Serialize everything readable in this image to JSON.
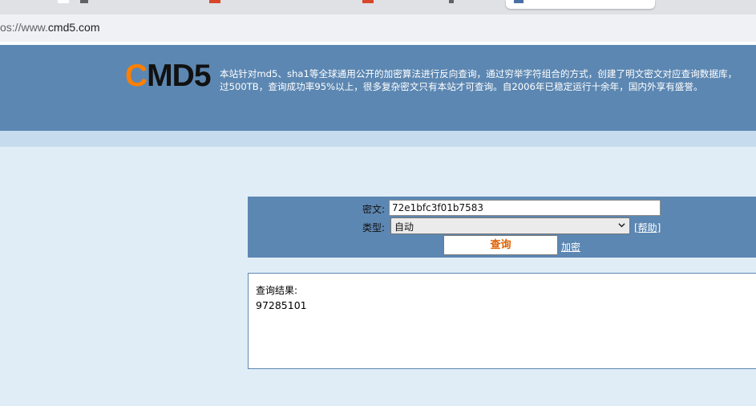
{
  "browser": {
    "url_prefix": "os://www.",
    "url_domain": "cmd5.com"
  },
  "logo": {
    "first": "C",
    "rest": "MD5"
  },
  "header": {
    "intro_line1": "本站针对md5、sha1等全球通用公开的加密算法进行反向查询，通过穷举字符组合的方式，创建了明文密文对应查询数据库，",
    "intro_line2": "过500TB，查询成功率95%以上，很多复杂密文只有本站才可查询。自2006年已稳定运行十余年，国内外享有盛誉。"
  },
  "form": {
    "cipher_label": "密文:",
    "cipher_value": "72e1bfc3f01b7583",
    "type_label": "类型:",
    "type_selected": "自动",
    "help_link": "[帮助]",
    "query_button": "查询",
    "encrypt_link": "加密"
  },
  "result": {
    "label": "查询结果:",
    "value": "97285101"
  },
  "colors": {
    "header_blue": "#5c87b2",
    "logo_orange": "#ff7f00",
    "button_text_orange": "#e06000",
    "page_bg": "#e0edf7"
  }
}
